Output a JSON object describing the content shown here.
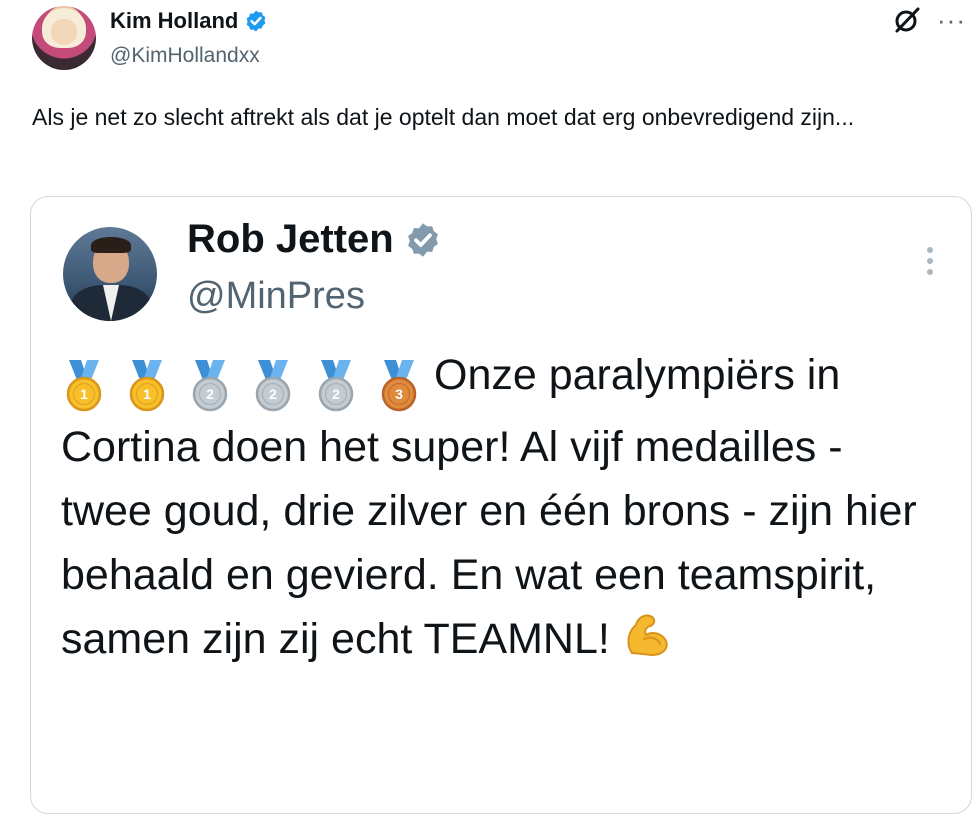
{
  "author": {
    "name": "Kim Holland",
    "handle": "@KimHollandxx",
    "verified": true
  },
  "post_text": "Als je net zo slecht aftrekt als dat je optelt dan moet dat erg onbevredigend zijn...",
  "icons": {
    "top_right": [
      "grok-icon",
      "more-icon"
    ],
    "more_symbol": "···"
  },
  "quoted": {
    "name": "Rob Jetten",
    "handle": "@MinPres",
    "verified": true,
    "medals": [
      {
        "type": "gold",
        "number": "1"
      },
      {
        "type": "gold",
        "number": "1"
      },
      {
        "type": "silver",
        "number": "2"
      },
      {
        "type": "silver",
        "number": "2"
      },
      {
        "type": "silver",
        "number": "2"
      },
      {
        "type": "bronze",
        "number": "3"
      }
    ],
    "text": "Onze paralympiërs in Cortina doen het super! Al vijf medailles - twee goud, drie zilver en één brons - zijn hier behaald en gevierd. En wat een teamspirit, samen zijn zij echt TEAMNL!",
    "trailing_emoji": "flexed-biceps-icon"
  },
  "colors": {
    "verified_blue": "#1d9bf0",
    "verified_gray": "#829aab",
    "secondary_text": "#536471",
    "border": "#cfd9de"
  }
}
